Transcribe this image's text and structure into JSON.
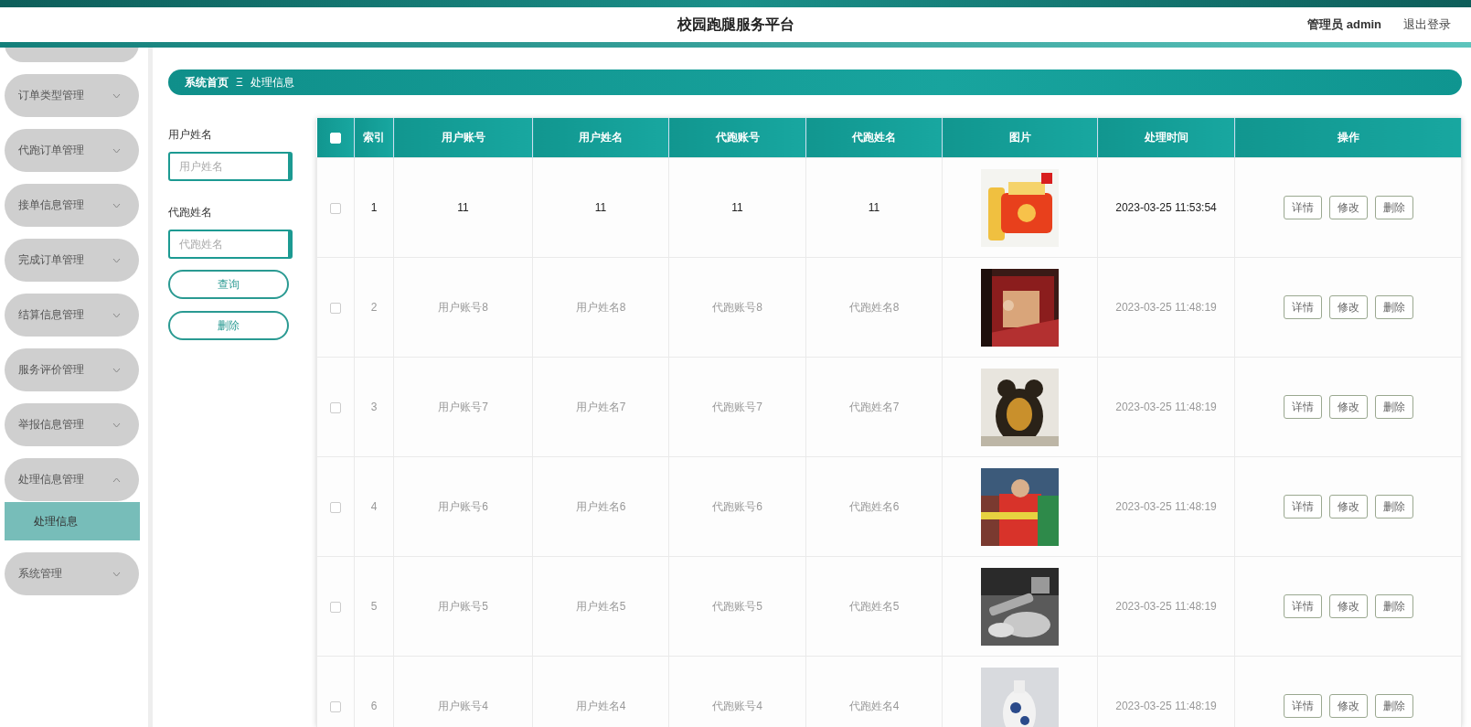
{
  "header": {
    "title": "校园跑腿服务平台",
    "user": "管理员 admin",
    "logout": "退出登录"
  },
  "sidebar": {
    "items": [
      {
        "label": "订单类型管理",
        "expanded": false
      },
      {
        "label": "代跑订单管理",
        "expanded": false
      },
      {
        "label": "接单信息管理",
        "expanded": false
      },
      {
        "label": "完成订单管理",
        "expanded": false
      },
      {
        "label": "结算信息管理",
        "expanded": false
      },
      {
        "label": "服务评价管理",
        "expanded": false
      },
      {
        "label": "举报信息管理",
        "expanded": false
      },
      {
        "label": "处理信息管理",
        "expanded": true,
        "children": [
          {
            "label": "处理信息",
            "selected": true
          }
        ]
      },
      {
        "label": "系统管理",
        "expanded": false
      }
    ]
  },
  "breadcrumb": {
    "home": "系统首页",
    "separator": "Ξ",
    "current": "处理信息"
  },
  "search": {
    "fields": [
      {
        "label": "用户姓名",
        "placeholder": "用户姓名"
      },
      {
        "label": "代跑姓名",
        "placeholder": "代跑姓名"
      }
    ],
    "buttons": [
      "查询",
      "删除"
    ]
  },
  "table": {
    "header_checked": false,
    "columns": [
      "索引",
      "用户账号",
      "用户姓名",
      "代跑账号",
      "代跑姓名",
      "图片",
      "处理时间",
      "操作"
    ],
    "rows": [
      {
        "checked": false,
        "highlighted": true,
        "cells": [
          "1",
          "11",
          "11",
          "11",
          "11"
        ],
        "image": {
          "kind": "picture"
        },
        "time": "2023-03-25 11:53:54",
        "actions": [
          "详情",
          "修改",
          "删除"
        ]
      },
      {
        "checked": false,
        "highlighted": false,
        "cells": [
          "2",
          "用户账号8",
          "用户姓名8",
          "代跑账号8",
          "代跑姓名8"
        ],
        "image": {
          "kind": "picture"
        },
        "time": "2023-03-25 11:48:19",
        "actions": [
          "详情",
          "修改",
          "删除"
        ]
      },
      {
        "checked": false,
        "highlighted": false,
        "cells": [
          "3",
          "用户账号7",
          "用户姓名7",
          "代跑账号7",
          "代跑姓名7"
        ],
        "image": {
          "kind": "picture"
        },
        "time": "2023-03-25 11:48:19",
        "actions": [
          "详情",
          "修改",
          "删除"
        ]
      },
      {
        "checked": false,
        "highlighted": false,
        "cells": [
          "4",
          "用户账号6",
          "用户姓名6",
          "代跑账号6",
          "代跑姓名6"
        ],
        "image": {
          "kind": "picture"
        },
        "time": "2023-03-25 11:48:19",
        "actions": [
          "详情",
          "修改",
          "删除"
        ]
      },
      {
        "checked": false,
        "highlighted": false,
        "cells": [
          "5",
          "用户账号5",
          "用户姓名5",
          "代跑账号5",
          "代跑姓名5"
        ],
        "image": {
          "kind": "picture"
        },
        "time": "2023-03-25 11:48:19",
        "actions": [
          "详情",
          "修改",
          "删除"
        ]
      },
      {
        "checked": false,
        "highlighted": false,
        "cells": [
          "6",
          "用户账号4",
          "用户姓名4",
          "代跑账号4",
          "代跑姓名4"
        ],
        "image": {
          "kind": "picture"
        },
        "time": "2023-03-25 11:48:19",
        "actions": [
          "详情",
          "修改",
          "删除"
        ]
      }
    ]
  }
}
